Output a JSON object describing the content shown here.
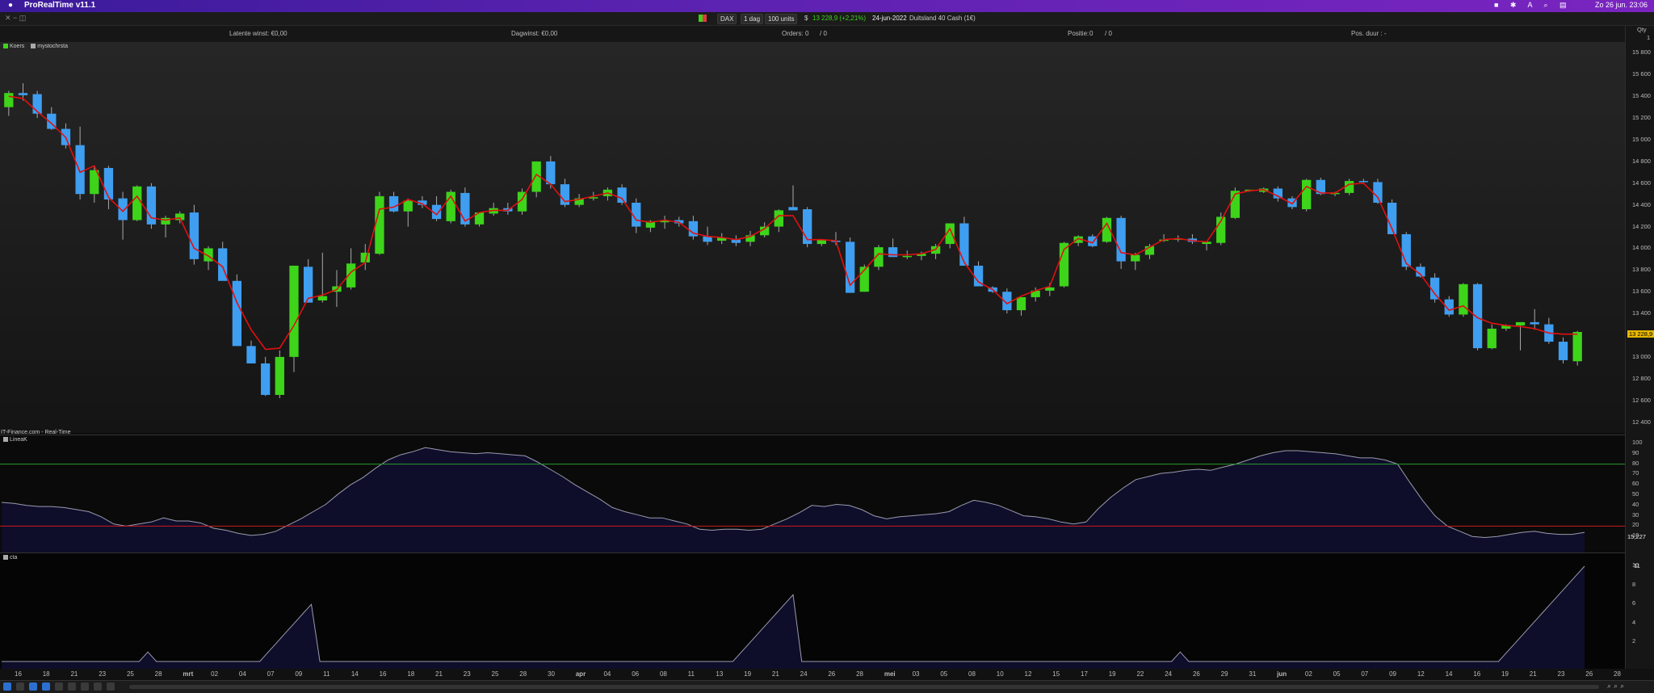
{
  "menubar": {
    "app_title": "ProRealTime v11.1",
    "clock": "Zo 26 jun.  23:06"
  },
  "toolbar": {
    "instrument": "DAX",
    "period": "1 dag",
    "units": "100 units",
    "price_label": "13 228,9 (+2,21%)",
    "date": "24-jun-2022",
    "description": "Duitsland 40 Cash (1€)"
  },
  "statusbar": {
    "latent": "Latente winst: €0,00",
    "daily": "Dagwinst: €0,00",
    "orders_label": "Orders:",
    "orders_a": "0",
    "orders_b": "/ 0",
    "position_label": "Positie:",
    "position_a": "0",
    "position_b": "/ 0",
    "duration": "Pos. duur : -"
  },
  "legend": {
    "koers": "Koers",
    "indicator": "mystochrsta",
    "source": "IT-Finance.com - Real-Time",
    "linea": "LineaK",
    "cta": "cta"
  },
  "right_panel": {
    "qty": "Qty",
    "one": "1"
  },
  "chart_data": {
    "type": "candlestick",
    "current_price_label": "13 228,9",
    "ylim": [
      12300,
      15900
    ],
    "y_ticks": [
      "15 800",
      "15 600",
      "15 400",
      "15 200",
      "15 000",
      "14 800",
      "14 600",
      "14 400",
      "14 200",
      "14 000",
      "13 800",
      "13 600",
      "13 400",
      "13 200",
      "13 000",
      "12 800",
      "12 600",
      "12 400"
    ],
    "x_ticks": [
      "16",
      "18",
      "21",
      "23",
      "25",
      "28",
      "mrt",
      "02",
      "04",
      "07",
      "09",
      "11",
      "14",
      "16",
      "18",
      "21",
      "23",
      "25",
      "28",
      "30",
      "apr",
      "04",
      "06",
      "08",
      "11",
      "13",
      "19",
      "21",
      "24",
      "26",
      "28",
      "mei",
      "03",
      "05",
      "08",
      "10",
      "12",
      "15",
      "17",
      "19",
      "22",
      "24",
      "26",
      "29",
      "31",
      "jun",
      "02",
      "05",
      "07",
      "09",
      "12",
      "14",
      "16",
      "19",
      "21",
      "23",
      "26",
      "28"
    ],
    "ohlc": [
      [
        15300,
        15450,
        15220,
        15430
      ],
      [
        15430,
        15520,
        15360,
        15410
      ],
      [
        15420,
        15450,
        15200,
        15240
      ],
      [
        15240,
        15300,
        15090,
        15100
      ],
      [
        15100,
        15150,
        14920,
        14950
      ],
      [
        14950,
        15120,
        14450,
        14500
      ],
      [
        14500,
        14760,
        14420,
        14720
      ],
      [
        14740,
        14760,
        14360,
        14450
      ],
      [
        14460,
        14520,
        14080,
        14260
      ],
      [
        14260,
        14580,
        14250,
        14570
      ],
      [
        14570,
        14600,
        14180,
        14220
      ],
      [
        14220,
        14300,
        14100,
        14280
      ],
      [
        14260,
        14340,
        14230,
        14320
      ],
      [
        14330,
        14400,
        13850,
        13900
      ],
      [
        13880,
        14020,
        13800,
        14000
      ],
      [
        14000,
        14060,
        13770,
        13700
      ],
      [
        13700,
        13760,
        13360,
        13100
      ],
      [
        13100,
        13150,
        13040,
        12940
      ],
      [
        12940,
        13000,
        12640,
        12650
      ],
      [
        12650,
        13060,
        12620,
        13000
      ],
      [
        13000,
        13540,
        12860,
        13840
      ],
      [
        13830,
        13900,
        13530,
        13500
      ],
      [
        13520,
        13960,
        13500,
        13560
      ],
      [
        13600,
        13800,
        13460,
        13650
      ],
      [
        13640,
        14000,
        13620,
        13860
      ],
      [
        13870,
        14040,
        13800,
        13960
      ],
      [
        13950,
        14520,
        13940,
        14480
      ],
      [
        14480,
        14520,
        14330,
        14340
      ],
      [
        14340,
        14460,
        14200,
        14440
      ],
      [
        14440,
        14480,
        14370,
        14400
      ],
      [
        14400,
        14480,
        14250,
        14270
      ],
      [
        14250,
        14540,
        14230,
        14520
      ],
      [
        14510,
        14560,
        14200,
        14220
      ],
      [
        14220,
        14320,
        14200,
        14330
      ],
      [
        14320,
        14420,
        14300,
        14370
      ],
      [
        14370,
        14420,
        14310,
        14340
      ],
      [
        14340,
        14550,
        14310,
        14520
      ],
      [
        14520,
        14800,
        14470,
        14800
      ],
      [
        14800,
        14850,
        14550,
        14590
      ],
      [
        14590,
        14640,
        14380,
        14400
      ],
      [
        14400,
        14500,
        14380,
        14460
      ],
      [
        14460,
        14520,
        14440,
        14470
      ],
      [
        14480,
        14560,
        14440,
        14540
      ],
      [
        14560,
        14590,
        14400,
        14420
      ],
      [
        14420,
        14460,
        14140,
        14200
      ],
      [
        14190,
        14260,
        14150,
        14250
      ],
      [
        14240,
        14300,
        14180,
        14260
      ],
      [
        14260,
        14290,
        14200,
        14230
      ],
      [
        14250,
        14300,
        14080,
        14110
      ],
      [
        14110,
        14200,
        14030,
        14060
      ],
      [
        14070,
        14140,
        14040,
        14100
      ],
      [
        14080,
        14120,
        14020,
        14050
      ],
      [
        14060,
        14160,
        14020,
        14120
      ],
      [
        14120,
        14240,
        14100,
        14200
      ],
      [
        14200,
        14360,
        14150,
        14350
      ],
      [
        14380,
        14580,
        14350,
        14350
      ],
      [
        14360,
        14380,
        14010,
        14040
      ],
      [
        14040,
        14080,
        14020,
        14080
      ],
      [
        14070,
        14150,
        14030,
        14060
      ],
      [
        14060,
        14100,
        13610,
        13590
      ],
      [
        13600,
        13850,
        13600,
        13830
      ],
      [
        13830,
        14030,
        13800,
        14010
      ],
      [
        14010,
        14090,
        13920,
        13920
      ],
      [
        13920,
        13980,
        13900,
        13930
      ],
      [
        13930,
        13970,
        13890,
        13950
      ],
      [
        13950,
        14040,
        13900,
        14020
      ],
      [
        14040,
        14200,
        14000,
        14230
      ],
      [
        14230,
        14290,
        14000,
        13840
      ],
      [
        13840,
        13880,
        13650,
        13650
      ],
      [
        13640,
        13650,
        13590,
        13600
      ],
      [
        13600,
        13630,
        13400,
        13430
      ],
      [
        13430,
        13540,
        13380,
        13550
      ],
      [
        13550,
        13640,
        13510,
        13610
      ],
      [
        13610,
        13680,
        13560,
        13640
      ],
      [
        13650,
        14060,
        13640,
        14050
      ],
      [
        14050,
        14120,
        14020,
        14110
      ],
      [
        14110,
        14130,
        14010,
        14020
      ],
      [
        14060,
        14290,
        14050,
        14280
      ],
      [
        14280,
        14300,
        13810,
        13880
      ],
      [
        13880,
        13960,
        13800,
        13940
      ],
      [
        13940,
        14040,
        13900,
        14020
      ],
      [
        14070,
        14130,
        14060,
        14080
      ],
      [
        14080,
        14120,
        14060,
        14090
      ],
      [
        14090,
        14130,
        14040,
        14060
      ],
      [
        14040,
        14050,
        13980,
        14060
      ],
      [
        14050,
        14330,
        14030,
        14290
      ],
      [
        14280,
        14560,
        14270,
        14530
      ],
      [
        14530,
        14540,
        14520,
        14540
      ],
      [
        14520,
        14560,
        14510,
        14550
      ],
      [
        14550,
        14570,
        14430,
        14460
      ],
      [
        14460,
        14480,
        14360,
        14380
      ],
      [
        14360,
        14640,
        14340,
        14630
      ],
      [
        14630,
        14650,
        14490,
        14500
      ],
      [
        14500,
        14520,
        14480,
        14510
      ],
      [
        14510,
        14640,
        14490,
        14620
      ],
      [
        14620,
        14640,
        14600,
        14610
      ],
      [
        14610,
        14640,
        14410,
        14420
      ],
      [
        14420,
        14450,
        14130,
        14130
      ],
      [
        14130,
        14150,
        13800,
        13830
      ],
      [
        13830,
        13860,
        13730,
        13740
      ],
      [
        13730,
        13770,
        13500,
        13530
      ],
      [
        13530,
        13560,
        13370,
        13390
      ],
      [
        13390,
        13680,
        13370,
        13670
      ],
      [
        13670,
        13680,
        13060,
        13080
      ],
      [
        13080,
        13300,
        13070,
        13260
      ],
      [
        13260,
        13300,
        13240,
        13290
      ],
      [
        13290,
        13320,
        13060,
        13320
      ],
      [
        13320,
        13440,
        13250,
        13300
      ],
      [
        13300,
        13360,
        13120,
        13140
      ],
      [
        13140,
        13180,
        12940,
        12970
      ],
      [
        12960,
        13240,
        12920,
        13230
      ]
    ],
    "ma": [
      15400,
      15380,
      15260,
      15150,
      15020,
      14700,
      14760,
      14470,
      14340,
      14480,
      14280,
      14260,
      14280,
      14000,
      13930,
      13830,
      13500,
      13250,
      13070,
      13080,
      13290,
      13540,
      13570,
      13620,
      13780,
      13870,
      14360,
      14380,
      14450,
      14410,
      14310,
      14480,
      14250,
      14330,
      14350,
      14350,
      14450,
      14680,
      14590,
      14430,
      14450,
      14480,
      14510,
      14460,
      14260,
      14240,
      14260,
      14240,
      14140,
      14110,
      14100,
      14080,
      14110,
      14180,
      14300,
      14300,
      14080,
      14080,
      14070,
      13660,
      13800,
      13950,
      13940,
      13940,
      13950,
      13990,
      14180,
      13870,
      13690,
      13620,
      13490,
      13560,
      13610,
      13650,
      13990,
      14090,
      14050,
      14230,
      13960,
      13940,
      14010,
      14080,
      14090,
      14070,
      14060,
      14250,
      14500,
      14530,
      14540,
      14480,
      14410,
      14570,
      14510,
      14510,
      14590,
      14600,
      14470,
      14180,
      13860,
      13760,
      13580,
      13430,
      13470,
      13360,
      13310,
      13290,
      13280,
      13260,
      13220,
      13210,
      13210
    ],
    "linea_k": [
      43,
      42,
      40,
      39,
      39,
      38,
      36,
      34,
      29,
      22,
      20,
      22,
      24,
      28,
      25,
      25,
      23,
      18,
      16,
      13,
      11,
      12,
      15,
      21,
      27,
      34,
      41,
      51,
      60,
      67,
      76,
      84,
      89,
      92,
      96,
      94,
      92,
      91,
      90,
      91,
      90,
      89,
      88,
      82,
      75,
      68,
      60,
      53,
      46,
      38,
      34,
      31,
      28,
      28,
      25,
      22,
      17,
      16,
      17,
      17,
      16,
      17,
      22,
      27,
      33,
      40,
      39,
      41,
      40,
      36,
      30,
      27,
      29,
      30,
      31,
      32,
      34,
      40,
      45,
      43,
      40,
      35,
      30,
      29,
      27,
      24,
      22,
      24,
      37,
      48,
      57,
      65,
      68,
      71,
      72,
      74,
      75,
      74,
      77,
      80,
      84,
      88,
      91,
      93,
      93,
      92,
      91,
      90,
      88,
      86,
      86,
      84,
      80,
      62,
      45,
      30,
      20,
      15,
      10,
      9,
      10,
      12,
      14,
      15,
      13,
      12,
      12,
      14
    ],
    "cta": [
      0,
      0,
      0,
      0,
      0,
      0,
      0,
      0,
      0,
      0,
      0,
      0,
      0,
      0,
      0,
      0,
      0,
      1,
      0,
      0,
      0,
      0,
      0,
      0,
      0,
      0,
      0,
      0,
      0,
      0,
      0,
      1,
      2,
      3,
      4,
      5,
      6,
      0,
      0,
      0,
      0,
      0,
      0,
      0,
      0,
      0,
      0,
      0,
      0,
      0,
      0,
      0,
      0,
      0,
      0,
      0,
      0,
      0,
      0,
      0,
      0,
      0,
      0,
      0,
      0,
      0,
      0,
      0,
      0,
      0,
      0,
      0,
      0,
      0,
      0,
      0,
      0,
      0,
      0,
      0,
      0,
      0,
      0,
      0,
      0,
      0,
      1,
      2,
      3,
      4,
      5,
      6,
      7,
      0,
      0,
      0,
      0,
      0,
      0,
      0,
      0,
      0,
      0,
      0,
      0,
      0,
      0,
      0,
      0,
      0,
      0,
      0,
      0,
      0,
      0,
      0,
      0,
      0,
      0,
      0,
      0,
      0,
      0,
      0,
      0,
      0,
      0,
      0,
      0,
      0,
      0,
      0,
      0,
      0,
      0,
      0,
      0,
      1,
      0,
      0,
      0,
      0,
      0,
      0,
      0,
      0,
      0,
      0,
      0,
      0,
      0,
      0,
      0,
      0,
      0,
      0,
      0,
      0,
      0,
      0,
      0,
      0,
      0,
      0,
      0,
      0,
      0,
      0,
      0,
      0,
      0,
      0,
      0,
      0,
      0,
      1,
      2,
      3,
      4,
      5,
      6,
      7,
      8,
      9,
      10
    ],
    "linea_levels": [
      20,
      80
    ],
    "linea_ticks": [
      "100",
      "90",
      "80",
      "70",
      "60",
      "50",
      "40",
      "30",
      "20",
      "10"
    ],
    "cta_ticks": [
      "10",
      "8",
      "6",
      "4",
      "2"
    ],
    "linea_value_label": "15,227",
    "cta_top_label": "11",
    "colors": {
      "up": "#3dd41a",
      "down": "#3f9ef0",
      "ma": "#e01010",
      "upper": "#2a9a2a",
      "lower": "#cc1a1a",
      "linea": "#9a9ab0"
    }
  }
}
